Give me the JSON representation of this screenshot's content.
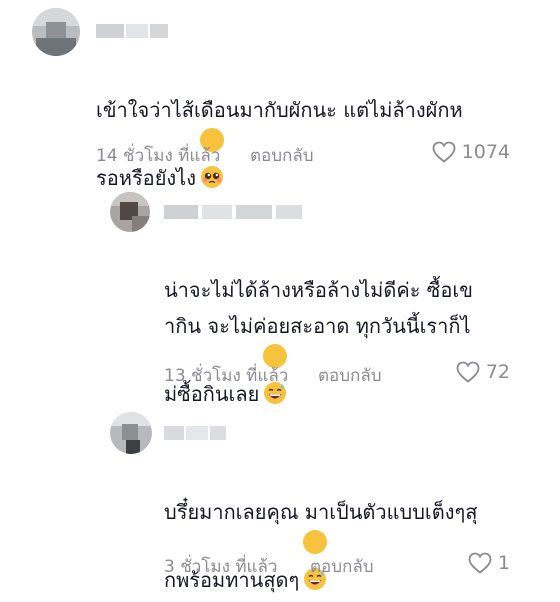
{
  "comments": [
    {
      "text": "เข้าใจว่าไส้เดือนมากับผักนะ แต่ไม่ล้างผักห\nรอหรือยังไง",
      "emoji": "pleading-face",
      "time": "14 ชั่วโมง ที่แล้ว",
      "reply": "ตอบกลับ",
      "likes": "1074"
    },
    {
      "text": "น่าจะไม่ได้ล้างหรือล้างไม่ดีค่ะ ซื้อเข\nากิน จะไม่ค่อยสะอาด ทุกวันนี้เราก็ไ\nม่ซื้อกินเลย",
      "emoji": "grinning-sweat-face",
      "time": "13 ชั่วโมง ที่แล้ว",
      "reply": "ตอบกลับ",
      "likes": "72"
    },
    {
      "text": "บรึ๋ยมากเลยคุณ มาเป็นตัวแบบเต็งๆสุ\nกพร้อมทานสุดๆ",
      "emoji": "grinning-sweat-face",
      "time": "3 ชั่วโมง ที่แล้ว",
      "reply": "ตอบกลับ",
      "likes": "1"
    }
  ],
  "colors": {
    "text": "#161823",
    "meta": "#8a8b91",
    "background": "#ffffff"
  }
}
